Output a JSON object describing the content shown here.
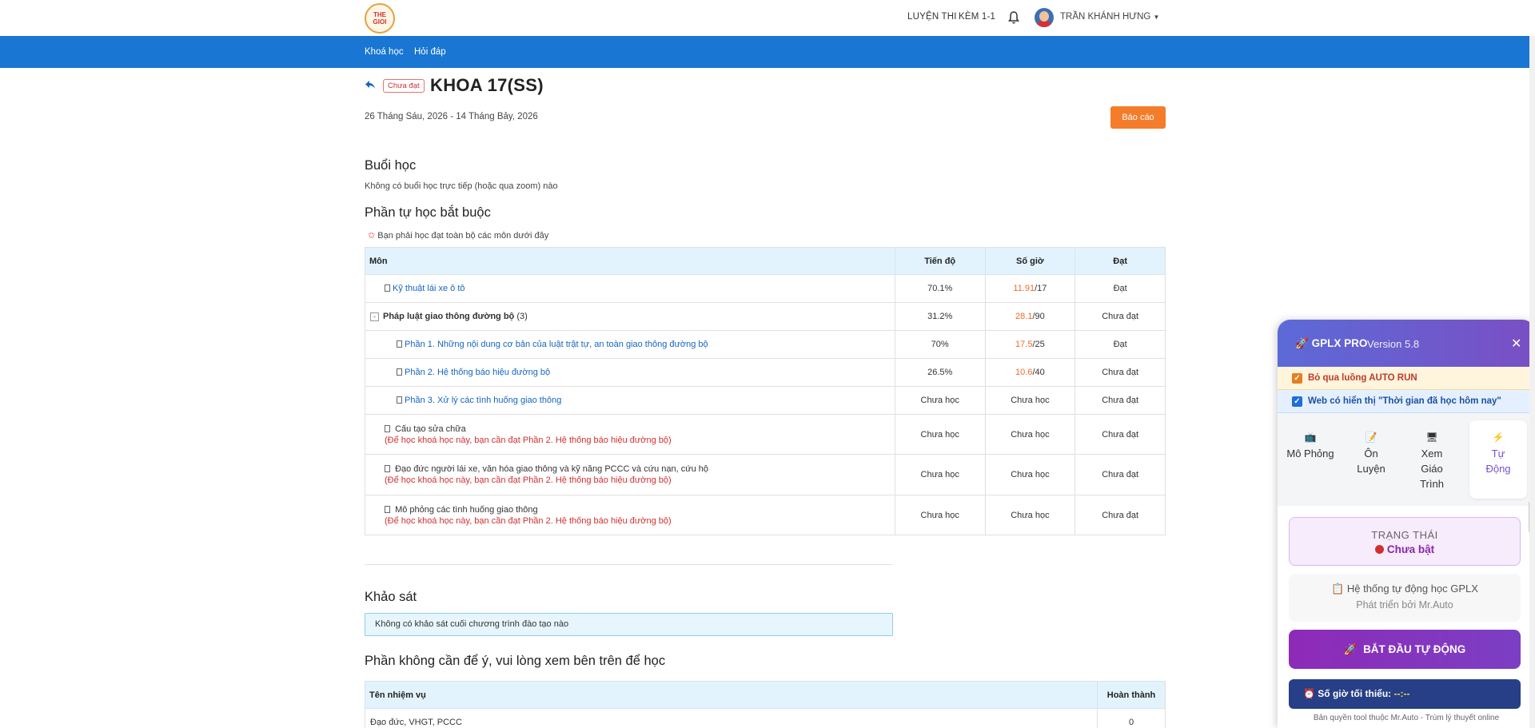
{
  "header": {
    "logo_text": "THE GIOI",
    "nav": [
      "LUYỆN THI",
      "KÈM 1-1"
    ],
    "user_name": "TRẦN KHÁNH HƯNG"
  },
  "bluenav": [
    "Khoá học",
    "Hỏi đáp"
  ],
  "course": {
    "status": "Chưa đạt",
    "title": "KHOA 17(SS)",
    "date_range": "26 Tháng Sáu, 2026 - 14 Tháng Bảy, 2026",
    "report_button": "Báo cáo"
  },
  "sessions": {
    "heading": "Buổi học",
    "text": "Không có buổi học trực tiếp (hoặc qua zoom) nào"
  },
  "required": {
    "heading": "Phần tự học bắt buộc",
    "note": "Bạn phải học đạt toàn bộ các môn dưới đây",
    "columns": [
      "Môn",
      "Tiến độ",
      "Số giờ",
      "Đạt"
    ],
    "rows": [
      {
        "name": "Kỹ thuật lái xe ô tô",
        "progress": "70.1%",
        "hours_done": "11.91",
        "hours_total": "/17",
        "hours_plain": "",
        "result": "Đạt",
        "note": ""
      },
      {
        "name": "Pháp luật giao thông đường bộ",
        "count": "(3)",
        "progress": "31.2%",
        "hours_done": "28.1",
        "hours_total": "/90",
        "hours_plain": "",
        "result": "Chưa đạt",
        "note": ""
      },
      {
        "name": "Phần 1. Những nội dung cơ bản của luật trật tự, an toàn giao thông đường bộ",
        "progress": "70%",
        "hours_done": "17.5",
        "hours_total": "/25",
        "hours_plain": "",
        "result": "Đạt",
        "note": ""
      },
      {
        "name": "Phần 2. Hệ thống báo hiệu đường bộ",
        "progress": "26.5%",
        "hours_done": "10.6",
        "hours_total": "/40",
        "hours_plain": "",
        "result": "Chưa đạt",
        "note": ""
      },
      {
        "name": "Phần 3. Xử lý các tình huống giao thông",
        "progress": "Chưa học",
        "hours_done": "",
        "hours_total": "",
        "hours_plain": "Chưa học",
        "result": "Chưa đạt",
        "note": ""
      },
      {
        "name": "Cấu tạo sửa chữa",
        "progress": "Chưa học",
        "hours_done": "",
        "hours_total": "",
        "hours_plain": "Chưa học",
        "result": "Chưa đạt",
        "note": "(Để học khoá học này, bạn cần đạt Phần 2. Hệ thống báo hiệu đường bộ)"
      },
      {
        "name": "Đạo đức người lái xe, văn hóa giao thông và kỹ năng PCCC và cứu nạn, cứu hộ",
        "progress": "Chưa học",
        "hours_done": "",
        "hours_total": "",
        "hours_plain": "Chưa học",
        "result": "Chưa đạt",
        "note": "(Để học khoá học này, bạn cần đạt Phần 2. Hệ thống báo hiệu đường bộ)"
      },
      {
        "name": "Mô phỏng các tình huống giao thông",
        "progress": "Chưa học",
        "hours_done": "",
        "hours_total": "",
        "hours_plain": "Chưa học",
        "result": "Chưa đạt",
        "note": "(Để học khoá học này, bạn cần đạt Phần 2. Hệ thống báo hiệu đường bộ)"
      }
    ]
  },
  "survey": {
    "heading": "Khảo sát",
    "text": "Không có khảo sát cuối chương trình đào tạo nào"
  },
  "optional": {
    "heading": "Phần không cần để ý, vui lòng xem bên trên để học",
    "columns": [
      "Tên nhiệm vụ",
      "Hoàn thành"
    ],
    "rows": [
      {
        "name": "Đạo đức, VHGT, PCCC",
        "done": "0"
      }
    ]
  },
  "panel": {
    "title": "GPLX PRO",
    "version": "Version 5.8",
    "close": "✕",
    "option1": "Bỏ qua luồng AUTO RUN",
    "option2": "Web có hiển thị \"Thời gian đã học hôm nay\"",
    "tabs": [
      {
        "label": "Mô Phỏng",
        "icon": "monitor-icon"
      },
      {
        "label": "Ôn Luyện",
        "icon": "notebook-icon"
      },
      {
        "label": "Xem Giáo Trình",
        "icon": "screen-icon"
      },
      {
        "label": "Tự Động",
        "icon": "lightning-icon"
      }
    ],
    "state_label": "TRẠNG THÁI",
    "state_value": "Chưa bật",
    "info_title": "Hệ thống tự động học GPLX",
    "info_sub": "Phát triển bởi Mr.Auto",
    "start_button": "BẮT ĐẦU TỰ ĐỘNG",
    "min_hours_label": "Số giờ tối thiểu:",
    "min_hours_value": "--:--",
    "copyright": "Bản quyền tool thuộc Mr.Auto - Trùm lý thuyết online"
  }
}
